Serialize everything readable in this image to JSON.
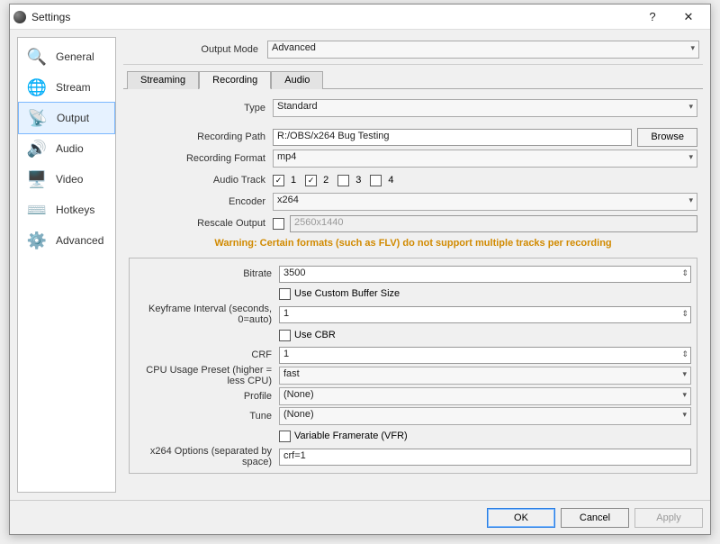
{
  "window": {
    "title": "Settings",
    "help": "?",
    "close": "✕"
  },
  "sidebar": {
    "items": [
      {
        "label": "General",
        "icon": "🔍"
      },
      {
        "label": "Stream",
        "icon": "🌐"
      },
      {
        "label": "Output",
        "icon": "📡"
      },
      {
        "label": "Audio",
        "icon": "🔊"
      },
      {
        "label": "Video",
        "icon": "🖥️"
      },
      {
        "label": "Hotkeys",
        "icon": "⌨️"
      },
      {
        "label": "Advanced",
        "icon": "⚙️"
      }
    ],
    "selected_index": 2
  },
  "output_mode": {
    "label": "Output Mode",
    "value": "Advanced"
  },
  "tabs": [
    {
      "label": "Streaming"
    },
    {
      "label": "Recording"
    },
    {
      "label": "Audio"
    }
  ],
  "active_tab_index": 1,
  "recording": {
    "type": {
      "label": "Type",
      "value": "Standard"
    },
    "path": {
      "label": "Recording Path",
      "value": "R:/OBS/x264 Bug Testing",
      "browse": "Browse"
    },
    "format": {
      "label": "Recording Format",
      "value": "mp4"
    },
    "audio_track": {
      "label": "Audio Track",
      "tracks": [
        {
          "n": "1",
          "checked": true
        },
        {
          "n": "2",
          "checked": true
        },
        {
          "n": "3",
          "checked": false
        },
        {
          "n": "4",
          "checked": false
        }
      ]
    },
    "encoder": {
      "label": "Encoder",
      "value": "x264"
    },
    "rescale": {
      "label": "Rescale Output",
      "checked": false,
      "value": "2560x1440"
    },
    "warning": "Warning: Certain formats (such as FLV) do not support multiple tracks per recording"
  },
  "encoder_settings": {
    "bitrate": {
      "label": "Bitrate",
      "value": "3500"
    },
    "custom_buffer": {
      "label": "Use Custom Buffer Size",
      "checked": false
    },
    "keyframe": {
      "label": "Keyframe Interval (seconds, 0=auto)",
      "value": "1"
    },
    "use_cbr": {
      "label": "Use CBR",
      "checked": false
    },
    "crf": {
      "label": "CRF",
      "value": "1"
    },
    "cpu_preset": {
      "label": "CPU Usage Preset (higher = less CPU)",
      "value": "fast"
    },
    "profile": {
      "label": "Profile",
      "value": "(None)"
    },
    "tune": {
      "label": "Tune",
      "value": "(None)"
    },
    "vfr": {
      "label": "Variable Framerate (VFR)",
      "checked": false
    },
    "x264opts": {
      "label": "x264 Options (separated by space)",
      "value": "crf=1"
    }
  },
  "footer": {
    "ok": "OK",
    "cancel": "Cancel",
    "apply": "Apply"
  }
}
